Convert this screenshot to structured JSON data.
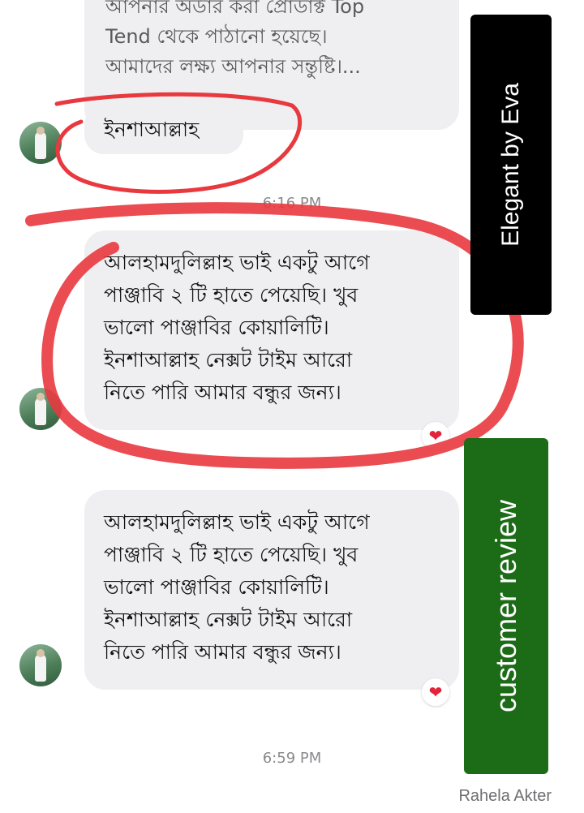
{
  "messages": {
    "top": {
      "lines": [
        "আপনার অর্ডার করা প্রোডাক্ট Top",
        "Tend থেকে  পাঠানো   হয়েছে।",
        "আমাদের লক্ষ্য আপনার সন্তুষ্টি।..."
      ]
    },
    "reply_short": {
      "text": "ইনশাআল্লাহ"
    },
    "review_1": {
      "lines": [
        "আলহামদুলিল্লাহ ভাই একটু আগে",
        "পাঞ্জাবি ২ টি হাতে পেয়েছি। খুব",
        "ভালো পাঞ্জাবির কোয়ালিটি।",
        "ইনশাআল্লাহ  নেক্সট টাইম আরো",
        "নিতে পারি আমার বন্ধুর জন্য।"
      ],
      "reaction": "❤"
    },
    "review_2": {
      "lines": [
        "আলহামদুলিল্লাহ ভাই একটু আগে",
        "পাঞ্জাবি ২ টি হাতে পেয়েছি। খুব",
        "ভালো পাঞ্জাবির কোয়ালিটি।",
        "ইনশাআল্লাহ  নেক্সট টাইম আরো",
        "নিতে পারি আমার বন্ধুর জন্য।"
      ],
      "reaction": "❤"
    }
  },
  "timestamps": {
    "first": "6:16 PM",
    "second": "6:59 PM"
  },
  "overlay_labels": {
    "brand": "Elegant by Eva",
    "caption": "customer review"
  },
  "sender_name": "Rahela Akter",
  "icons": {
    "reaction": "heart-icon",
    "avatar": "profile-photo"
  },
  "colors": {
    "bubble": "#efeff1",
    "annotation_circle": "#e8393f",
    "brand_label_bg": "#000000",
    "caption_label_bg": "#1c6b17",
    "heart": "#e2243b"
  }
}
